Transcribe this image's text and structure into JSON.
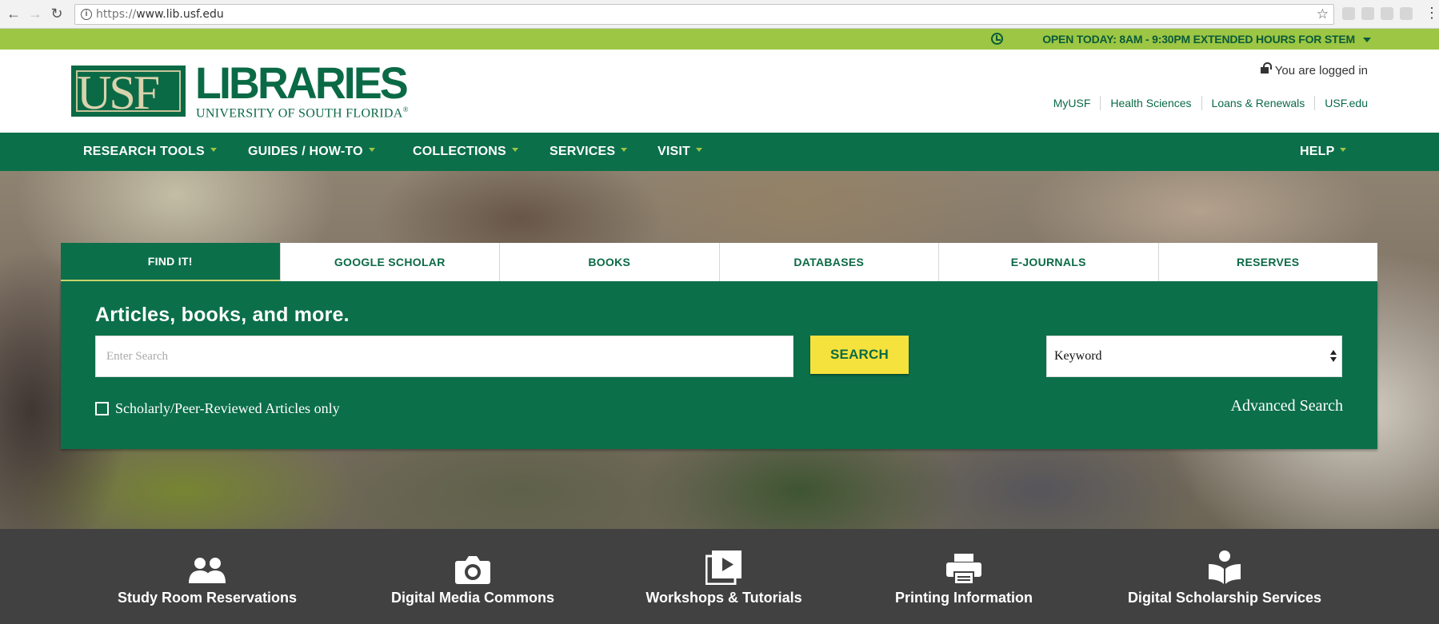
{
  "browser": {
    "url_prefix": "https://",
    "url_host": "www.lib.usf.edu"
  },
  "hours_bar": {
    "text": "OPEN TODAY: 8AM - 9:30PM EXTENDED HOURS FOR STEM"
  },
  "header": {
    "logo_usf": "USF",
    "logo_libraries": "LIBRARIES",
    "logo_subtitle": "UNIVERSITY OF SOUTH FLORIDA",
    "logo_registered": "®",
    "login_status": "You are logged in",
    "utility_links": [
      "MyUSF",
      "Health Sciences",
      "Loans & Renewals",
      "USF.edu"
    ]
  },
  "main_nav": {
    "items": [
      "RESEARCH TOOLS",
      "GUIDES / HOW-TO",
      "COLLECTIONS",
      "SERVICES",
      "VISIT"
    ],
    "help": "HELP"
  },
  "search": {
    "tabs": [
      "FIND IT!",
      "GOOGLE SCHOLAR",
      "BOOKS",
      "DATABASES",
      "E-JOURNALS",
      "RESERVES"
    ],
    "active_tab": "FIND IT!",
    "headline": "Articles, books, and more.",
    "placeholder": "Enter Search",
    "button": "SEARCH",
    "select_value": "Keyword",
    "checkbox_label": "Scholarly/Peer-Reviewed Articles only",
    "advanced": "Advanced Search"
  },
  "quick_links": [
    {
      "label": "Study Room Reservations",
      "icon": "people-icon"
    },
    {
      "label": "Digital Media Commons",
      "icon": "camera-icon"
    },
    {
      "label": "Workshops & Tutorials",
      "icon": "video-play-icon"
    },
    {
      "label": "Printing Information",
      "icon": "printer-icon"
    },
    {
      "label": "Digital Scholarship Services",
      "icon": "book-reader-icon"
    }
  ],
  "colors": {
    "brand_green": "#0b6f4a",
    "accent_lime": "#9cc643",
    "search_yellow": "#f5e23c",
    "footer_gray": "#414141"
  }
}
